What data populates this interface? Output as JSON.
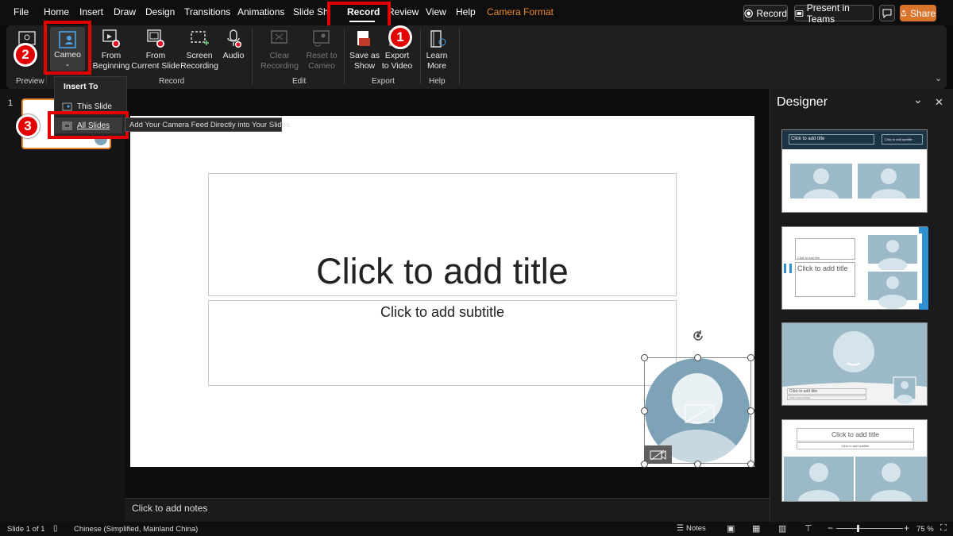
{
  "menu": {
    "tabs": [
      "File",
      "Home",
      "Insert",
      "Draw",
      "Design",
      "Transitions",
      "Animations",
      "Slide Show",
      "Record",
      "Review",
      "View",
      "Help"
    ],
    "active": "Record",
    "contextual_tab": "Camera Format"
  },
  "top_buttons": {
    "record": "Record",
    "present_teams": "Present in Teams",
    "share": "Share"
  },
  "ribbon": {
    "preview": {
      "label": "Preview"
    },
    "cameo": {
      "label": "Cameo"
    },
    "from_beginning": {
      "line1": "From",
      "line2": "Beginning"
    },
    "from_current": {
      "line1": "From",
      "line2": "Current Slide"
    },
    "screen_recording": {
      "line1": "Screen",
      "line2": "Recording"
    },
    "audio": {
      "label": "Audio"
    },
    "clear_recording": {
      "line1": "Clear",
      "line2": "Recording"
    },
    "reset_cameo": {
      "line1": "Reset to",
      "line2": "Cameo"
    },
    "save_show": {
      "line1": "Save as",
      "line2": "Show"
    },
    "export_video": {
      "line1": "Export",
      "line2": "to Video"
    },
    "learn_more": {
      "line1": "Learn",
      "line2": "More"
    },
    "groups": {
      "preview": "Preview",
      "record": "Record",
      "edit": "Edit",
      "export": "Export",
      "help": "Help"
    }
  },
  "dropdown": {
    "header": "Insert To",
    "this_slide": "This Slide",
    "all_slides": "All Slides"
  },
  "tooltip": "Add Your Camera Feed Directly into Your Slides.",
  "badges": {
    "one": "1",
    "two": "2",
    "three": "3"
  },
  "thumbnail": {
    "number": "1"
  },
  "slide": {
    "title": "Click to add title",
    "subtitle": "Click to add subtitle"
  },
  "notes": "Click to add notes",
  "designer": {
    "title": "Designer",
    "d1": {
      "title": "Click to add title",
      "subtitle": "Click to add subtitle"
    },
    "d2": {
      "title": "Click to add title",
      "small": "Click to add title"
    },
    "d3": {
      "title": "Click to add title",
      "subtitle": "Click to add subtitle"
    },
    "d4": {
      "title": "Click to add title",
      "subtitle": "Click to add subtitle"
    }
  },
  "status": {
    "slide": "Slide 1 of 1",
    "language": "Chinese (Simplified, Mainland China)",
    "notes": "Notes",
    "zoom": "75 %"
  },
  "colors": {
    "accent": "#e8852f",
    "highlight": "#e30000",
    "cameo": "#7ea3b7",
    "ribbon": "#1f1f1f"
  }
}
